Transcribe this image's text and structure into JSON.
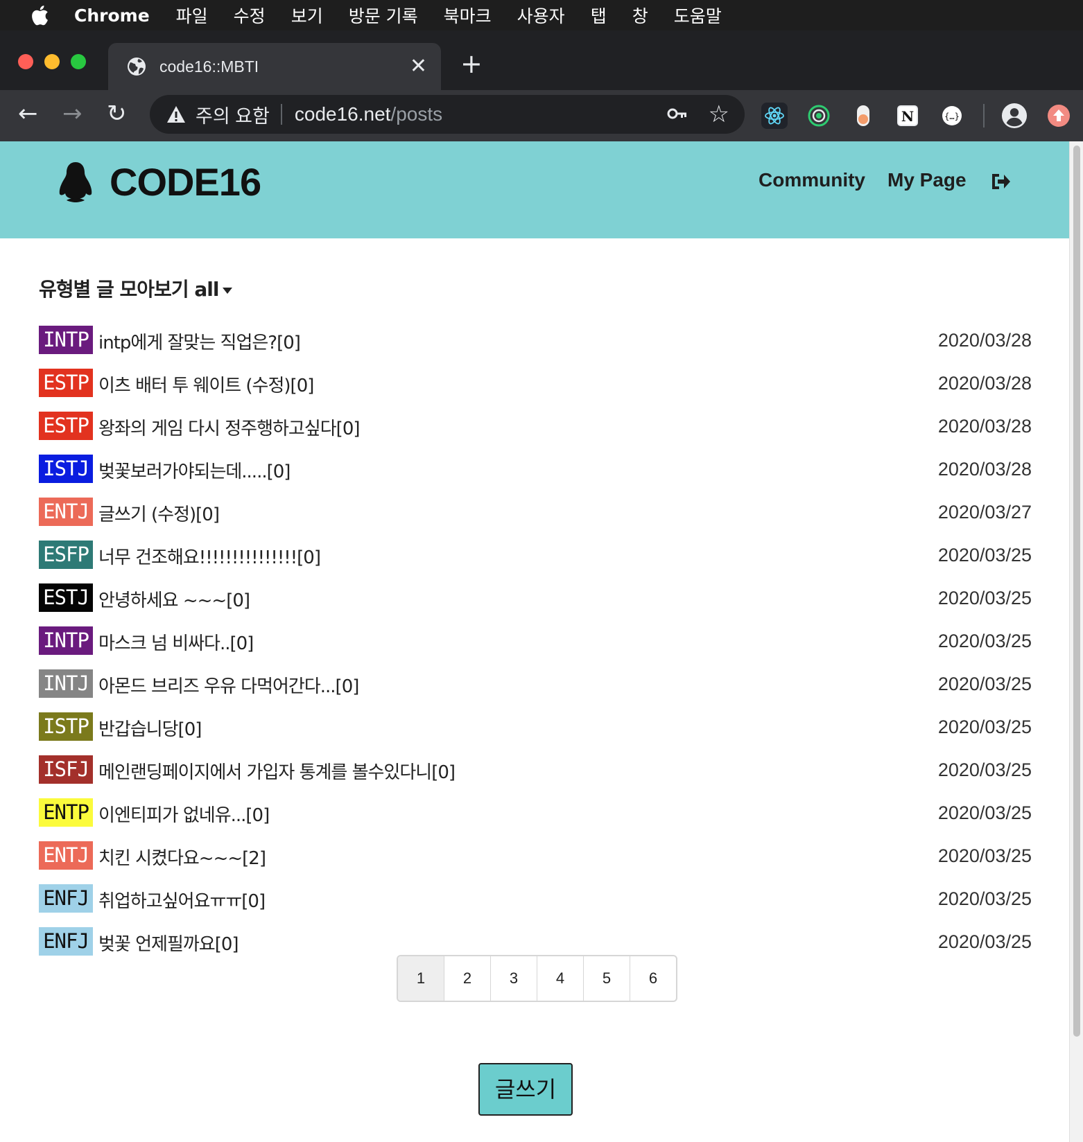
{
  "menubar": {
    "app": "Chrome",
    "items": [
      "파일",
      "수정",
      "보기",
      "방문 기록",
      "북마크",
      "사용자",
      "탭",
      "창",
      "도움말"
    ]
  },
  "browser": {
    "tab_title": "code16::MBTI",
    "close_glyph": "✕",
    "newtab_glyph": "+",
    "security_label": "주의 요함",
    "url_host": "code16.net",
    "url_path": "/posts",
    "back_glyph": "←",
    "forward_glyph": "→",
    "reload_glyph": "↻",
    "star_glyph": "☆",
    "extensions": [
      "react-devtools-icon",
      "record-icon",
      "toggle-icon",
      "notion-icon",
      "json-viewer-icon"
    ]
  },
  "site": {
    "brand": "CODE16",
    "nav": {
      "community": "Community",
      "mypage": "My Page"
    }
  },
  "filter": {
    "label": "유형별 글 모아보기 all"
  },
  "posts": [
    {
      "type": "INTP",
      "color": "#6a1b7e",
      "title": "intp에게 잘맞는 직업은?[0]",
      "date": "2020/03/28"
    },
    {
      "type": "ESTP",
      "color": "#e2321f",
      "title": "이츠 배터 투 웨이트 (수정)[0]",
      "date": "2020/03/28"
    },
    {
      "type": "ESTP",
      "color": "#e2321f",
      "title": "왕좌의 게임 다시 정주행하고싶다[0]",
      "date": "2020/03/28"
    },
    {
      "type": "ISTJ",
      "color": "#0a1de0",
      "title": "벚꽃보러가야되는데.....[0]",
      "date": "2020/03/28"
    },
    {
      "type": "ENTJ",
      "color": "#ec6a58",
      "title": "글쓰기 (수정)[0]",
      "date": "2020/03/27"
    },
    {
      "type": "ESFP",
      "color": "#2e7a76",
      "title": "너무 건조해요!!!!!!!!!!!!!!![0]",
      "date": "2020/03/25"
    },
    {
      "type": "ESTJ",
      "color": "#050505",
      "title": "안녕하세요 ~~~[0]",
      "date": "2020/03/25"
    },
    {
      "type": "INTP",
      "color": "#6a1b7e",
      "title": "마스크 넘 비싸다..[0]",
      "date": "2020/03/25"
    },
    {
      "type": "INTJ",
      "color": "#858585",
      "title": "아몬드 브리즈 우유 다먹어간다...[0]",
      "date": "2020/03/25"
    },
    {
      "type": "ISTP",
      "color": "#7b7a1c",
      "title": "반갑습니당[0]",
      "date": "2020/03/25"
    },
    {
      "type": "ISFJ",
      "color": "#a3302b",
      "title": "메인랜딩페이지에서 가입자 통계를 볼수있다니[0]",
      "date": "2020/03/25"
    },
    {
      "type": "ENTP",
      "color": "#fbfb3c",
      "text_color": "#111111",
      "title": "이엔티피가 없네유...[0]",
      "date": "2020/03/25"
    },
    {
      "type": "ENTJ",
      "color": "#ec6a58",
      "title": "치킨 시켰다요~~~[2]",
      "date": "2020/03/25"
    },
    {
      "type": "ENFJ",
      "color": "#9fd1e8",
      "text_color": "#111111",
      "title": "취업하고싶어요ㅠㅠ[0]",
      "date": "2020/03/25"
    },
    {
      "type": "ENFJ",
      "color": "#9fd1e8",
      "text_color": "#111111",
      "title": "벚꽃 언제필까요[0]",
      "date": "2020/03/25"
    }
  ],
  "pagination": {
    "pages": [
      "1",
      "2",
      "3",
      "4",
      "5",
      "6"
    ],
    "current": "1"
  },
  "write_button": "글쓰기",
  "colors": {
    "header_bg": "#7fd1d3",
    "write_btn": "#6bcdcd"
  }
}
